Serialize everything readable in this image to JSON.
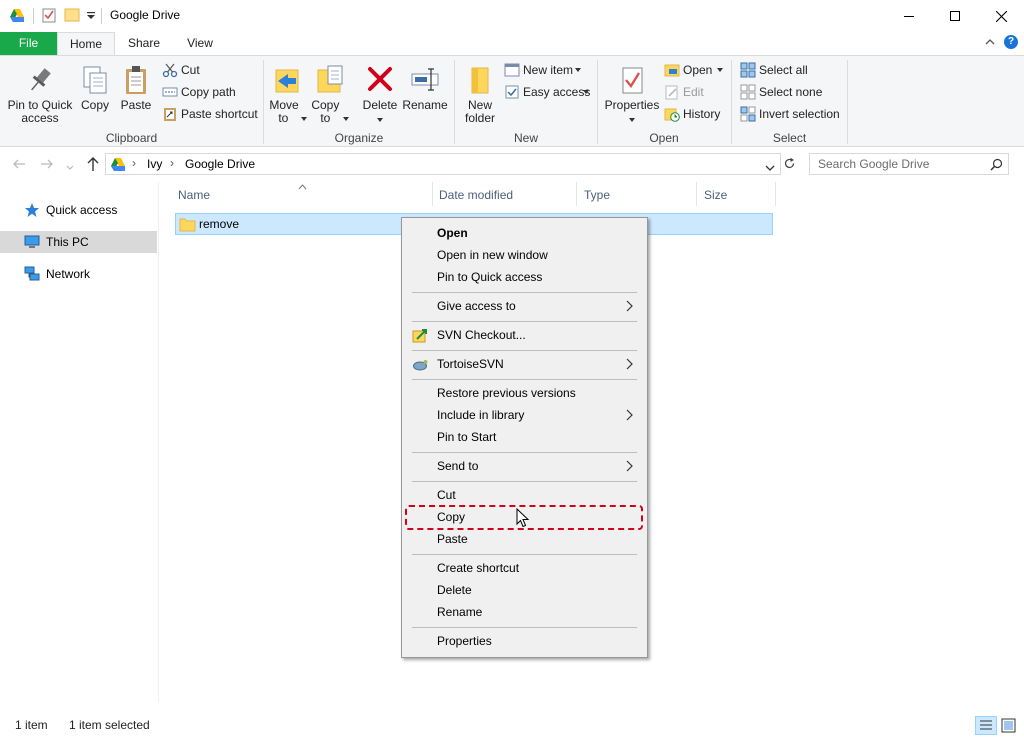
{
  "window": {
    "title": "Google Drive",
    "controls": {
      "minimize": "—",
      "maximize": "☐",
      "close": "✕"
    }
  },
  "ribbon_tabs": [
    "File",
    "Home",
    "Share",
    "View"
  ],
  "ribbon": {
    "clipboard": {
      "label": "Clipboard",
      "pin": "Pin to Quick access",
      "copy": "Copy",
      "paste": "Paste",
      "cut": "Cut",
      "copy_path": "Copy path",
      "paste_shortcut": "Paste shortcut"
    },
    "organize": {
      "label": "Organize",
      "move_to": "Move to",
      "copy_to": "Copy to",
      "delete": "Delete",
      "rename": "Rename"
    },
    "new": {
      "label": "New",
      "new_folder": "New folder",
      "new_item": "New item",
      "easy_access": "Easy access"
    },
    "open": {
      "label": "Open",
      "properties": "Properties",
      "open": "Open",
      "edit": "Edit",
      "history": "History"
    },
    "select": {
      "label": "Select",
      "select_all": "Select all",
      "select_none": "Select none",
      "invert_selection": "Invert selection"
    }
  },
  "address": {
    "path": [
      "Ivy",
      "Google Drive"
    ],
    "search_placeholder": "Search Google Drive"
  },
  "nav_pane": [
    "Quick access",
    "This PC",
    "Network"
  ],
  "columns": [
    "Name",
    "Date modified",
    "Type",
    "Size"
  ],
  "files": [
    {
      "name": "remove",
      "selected": true
    }
  ],
  "context_menu": {
    "items": [
      {
        "label": "Open",
        "bold": true
      },
      {
        "label": "Open in new window"
      },
      {
        "label": "Pin to Quick access"
      },
      {
        "label": "Give access to",
        "submenu": true
      },
      {
        "label": "SVN Checkout..."
      },
      {
        "label": "TortoiseSVN",
        "submenu": true
      },
      {
        "label": "Restore previous versions"
      },
      {
        "label": "Include in library",
        "submenu": true
      },
      {
        "label": "Pin to Start"
      },
      {
        "label": "Send to",
        "submenu": true
      },
      {
        "label": "Cut"
      },
      {
        "label": "Copy",
        "highlighted": true
      },
      {
        "label": "Paste"
      },
      {
        "label": "Create shortcut"
      },
      {
        "label": "Delete"
      },
      {
        "label": "Rename"
      },
      {
        "label": "Properties"
      }
    ]
  },
  "status": {
    "item_count": "1 item",
    "selected": "1 item selected"
  },
  "colors": {
    "file_tab": "#19a84a",
    "selection": "#cce8ff",
    "highlight_border": "#d0021b"
  }
}
